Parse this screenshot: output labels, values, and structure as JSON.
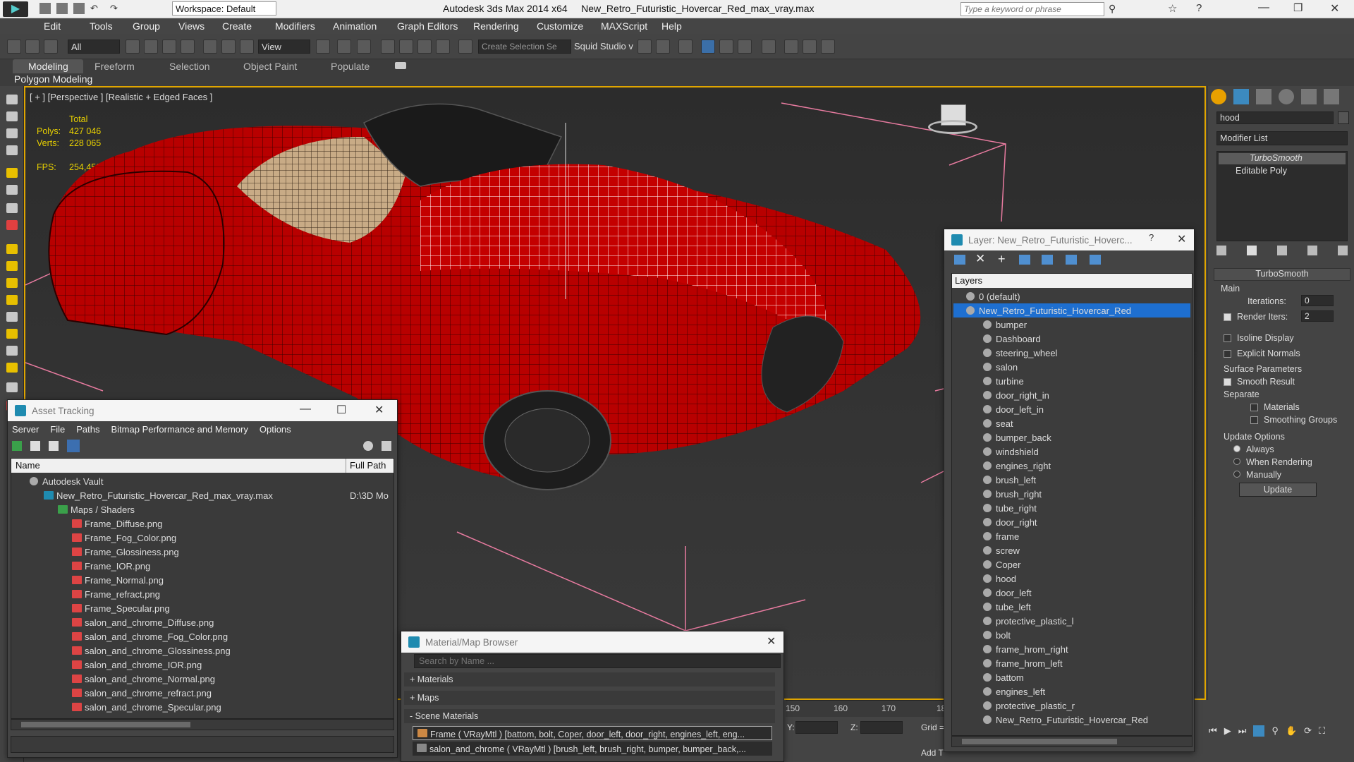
{
  "title": {
    "app": "Autodesk 3ds Max  2014 x64",
    "file": "New_Retro_Futuristic_Hovercar_Red_max_vray.max",
    "workspace": "Workspace: Default",
    "search_placeholder": "Type a keyword or phrase"
  },
  "menu": [
    "Edit",
    "Tools",
    "Group",
    "Views",
    "Create",
    "Modifiers",
    "Animation",
    "Graph Editors",
    "Rendering",
    "Customize",
    "MAXScript",
    "Help"
  ],
  "toolbar": {
    "selection_filter": "All",
    "ref_coord": "View",
    "named_selection": "Create Selection Se",
    "squid": "Squid Studio v"
  },
  "ribbon": {
    "tabs": [
      "Modeling",
      "Freeform",
      "Selection",
      "Object Paint",
      "Populate"
    ],
    "sub": "Polygon Modeling"
  },
  "viewport": {
    "label": "[ + ] [Perspective ] [Realistic + Edged Faces ]",
    "stats_total": "Total",
    "polys_label": "Polys:",
    "polys_value": "427 046",
    "verts_label": "Verts:",
    "verts_value": "228 065",
    "fps_label": "FPS:",
    "fps_value": "254,459"
  },
  "asset_tracking": {
    "title": "Asset Tracking",
    "menu": [
      "Server",
      "File",
      "Paths",
      "Bitmap Performance and Memory",
      "Options"
    ],
    "col_name": "Name",
    "col_path": "Full Path",
    "vault": "Autodesk Vault",
    "file": "New_Retro_Futuristic_Hovercar_Red_max_vray.max",
    "file_path": "D:\\3D Mo",
    "maps_folder": "Maps / Shaders",
    "maps": [
      "Frame_Diffuse.png",
      "Frame_Fog_Color.png",
      "Frame_Glossiness.png",
      "Frame_IOR.png",
      "Frame_Normal.png",
      "Frame_refract.png",
      "Frame_Specular.png",
      "salon_and_chrome_Diffuse.png",
      "salon_and_chrome_Fog_Color.png",
      "salon_and_chrome_Glossiness.png",
      "salon_and_chrome_IOR.png",
      "salon_and_chrome_Normal.png",
      "salon_and_chrome_refract.png",
      "salon_and_chrome_Specular.png"
    ]
  },
  "material_browser": {
    "title": "Material/Map Browser",
    "search_placeholder": "Search by Name ...",
    "groups": [
      "+ Materials",
      "+ Maps",
      "- Scene Materials"
    ],
    "scene_materials": [
      "Frame  ( VRayMtl ) [battom, bolt, Coper, door_left, door_right, engines_left, eng...",
      "salon_and_chrome  ( VRayMtl ) [brush_left, brush_right, bumper, bumper_back,..."
    ]
  },
  "layer_explorer": {
    "title": "Layer: New_Retro_Futuristic_Hoverc...",
    "help": "?",
    "header": "Layers",
    "default_layer": "0 (default)",
    "selected_layer": "New_Retro_Futuristic_Hovercar_Red",
    "objects": [
      "bumper",
      "Dashboard",
      "steering_wheel",
      "salon",
      "turbine",
      "door_right_in",
      "door_left_in",
      "seat",
      "bumper_back",
      "windshield",
      "engines_right",
      "brush_left",
      "brush_right",
      "tube_right",
      "door_right",
      "frame",
      "screw",
      "Coper",
      "hood",
      "door_left",
      "tube_left",
      "protective_plastic_l",
      "bolt",
      "frame_hrom_right",
      "frame_hrom_left",
      "battom",
      "engines_left",
      "protective_plastic_r",
      "New_Retro_Futuristic_Hovercar_Red"
    ]
  },
  "command_panel": {
    "object_name": "hood",
    "modifier_list": "Modifier List",
    "stack": [
      "TurboSmooth",
      "Editable Poly"
    ],
    "rollout": "TurboSmooth",
    "main": "Main",
    "iterations_label": "Iterations:",
    "iterations": "0",
    "render_iters_label": "Render Iters:",
    "render_iters": "2",
    "isoline": "Isoline Display",
    "explicit": "Explicit Normals",
    "surface": "Surface Parameters",
    "smooth_result": "Smooth Result",
    "separate": "Separate",
    "materials": "Materials",
    "smoothing": "Smoothing Groups",
    "update_options": "Update Options",
    "always": "Always",
    "when_rendering": "When Rendering",
    "manually": "Manually",
    "update_btn": "Update"
  },
  "timeline": {
    "ticks": [
      "150",
      "160",
      "170",
      "18"
    ],
    "y_label": "Y:",
    "z_label": "Z:",
    "grid": "Grid =",
    "add_time": "Add T"
  },
  "colors": {
    "accent": "#e0a500",
    "selection": "#1e6fd0",
    "car_red": "#b30000"
  }
}
